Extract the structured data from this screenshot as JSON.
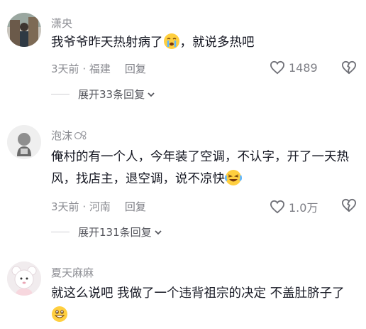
{
  "comments": [
    {
      "username": "潇央",
      "text": "我爷爷昨天热射病了",
      "text_after": "，就说多热吧",
      "time": "3天前",
      "location": "福建",
      "reply_label": "回复",
      "likes": "1489",
      "expand_label": "展开33条回复"
    },
    {
      "username": "泡沫",
      "text": "俺村的有一个人，今年装了空调，不认字，开了一天热风，找店主，退空调，说不凉快",
      "time": "3天前",
      "location": "河南",
      "reply_label": "回复",
      "likes": "1.0万",
      "expand_label": "展开131条回复"
    },
    {
      "username": "夏天麻麻",
      "text": "就这么说吧 我做了一个违背祖宗的决定 不盖肚脐子了"
    }
  ]
}
